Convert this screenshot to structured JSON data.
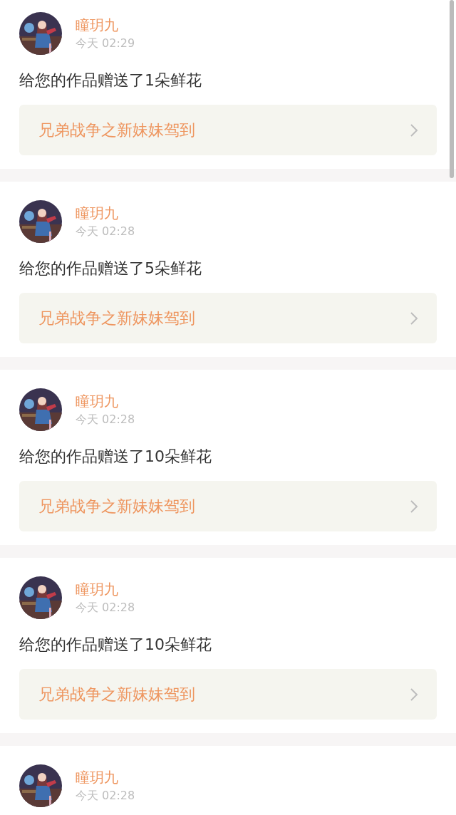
{
  "notifications": [
    {
      "user": "瞳玥九",
      "time": "今天 02:29",
      "message": "给您的作品赠送了1朵鲜花",
      "work_title": "兄弟战争之新妹妹驾到"
    },
    {
      "user": "瞳玥九",
      "time": "今天 02:28",
      "message": "给您的作品赠送了5朵鲜花",
      "work_title": "兄弟战争之新妹妹驾到"
    },
    {
      "user": "瞳玥九",
      "time": "今天 02:28",
      "message": "给您的作品赠送了10朵鲜花",
      "work_title": "兄弟战争之新妹妹驾到"
    },
    {
      "user": "瞳玥九",
      "time": "今天 02:28",
      "message": "给您的作品赠送了10朵鲜花",
      "work_title": "兄弟战争之新妹妹驾到"
    },
    {
      "user": "瞳玥九",
      "time": "今天 02:28"
    }
  ]
}
